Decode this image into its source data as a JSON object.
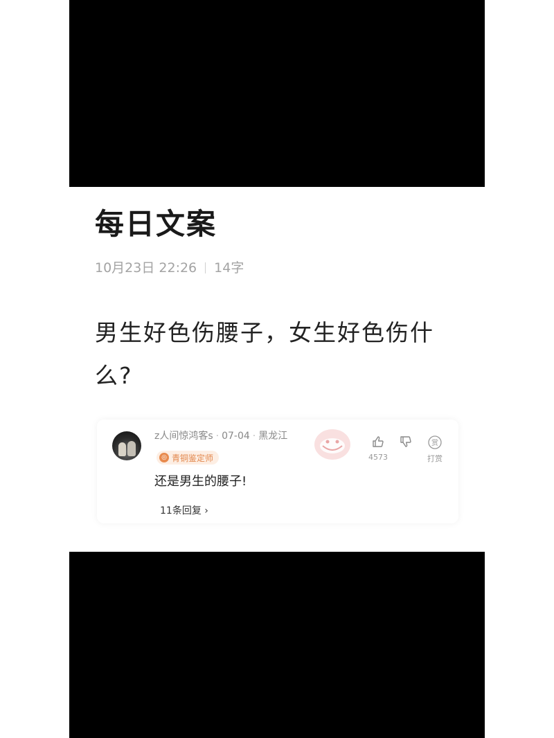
{
  "article": {
    "title": "每日文案",
    "date": "10月23日 22:26",
    "word_count": "14字",
    "body": "男生好色伤腰子，女生好色伤什么?"
  },
  "comment": {
    "username": "z人间惊鸿客s",
    "date": "07-04",
    "location": "黑龙江",
    "badge": "青铜鉴定师",
    "text": "还是男生的腰子!",
    "replies": "11条回复 ›",
    "like_count": "4573",
    "reward_label": "打赏",
    "reward_glyph": "赏",
    "badge_icon": "medal-icon",
    "accent_color": "#e88a4d"
  }
}
